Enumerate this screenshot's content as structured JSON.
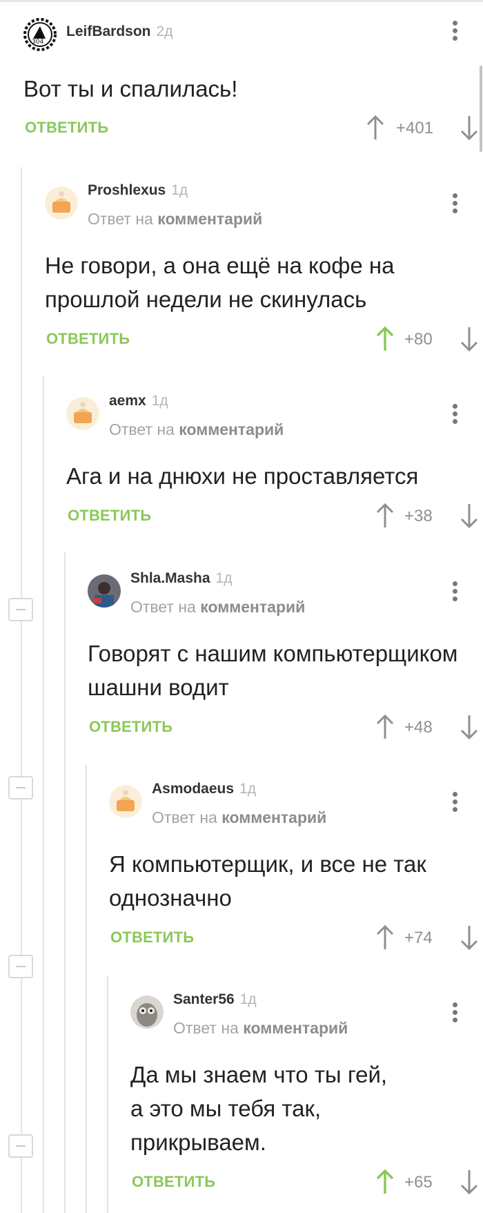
{
  "reply_label": "ОТВЕТИТЬ",
  "reply_prefix": "Ответ на",
  "reply_target": "комментарий",
  "colors": {
    "accent_green": "#8ac858",
    "vote_up_active": "#8ac858",
    "vote_neutral": "#8f8f8f"
  },
  "comments": [
    {
      "author": "LeifBardson",
      "time": "2д",
      "text": "Вот ты и спалилась!",
      "score": "+401",
      "upvoted": false,
      "avatar": "gear-emblem-avatar"
    },
    {
      "author": "Proshlexus",
      "time": "1д",
      "text": "Не говори, а она ещё на кофе на прошлой недели не скинулась",
      "score": "+80",
      "upvoted": true,
      "avatar": "cake-avatar"
    },
    {
      "author": "aemx",
      "time": "1д",
      "text": "Ага и на днюхи не проставляется",
      "score": "+38",
      "upvoted": false,
      "avatar": "cake-avatar"
    },
    {
      "author": "Shla.Masha",
      "time": "1д",
      "text": "Говорят с нашим компьютерщиком шашни водит",
      "score": "+48",
      "upvoted": false,
      "avatar": "photo-avatar"
    },
    {
      "author": "Asmodaeus",
      "time": "1д",
      "text": "Я компьютерщик, и все не так однозначно",
      "score": "+74",
      "upvoted": false,
      "avatar": "cake-avatar"
    },
    {
      "author": "Santer56",
      "time": "1д",
      "text": "Да мы знаем что ты гей, а это мы тебя так, прикрываем.",
      "score": "+65",
      "upvoted": true,
      "avatar": "owl-avatar"
    }
  ]
}
